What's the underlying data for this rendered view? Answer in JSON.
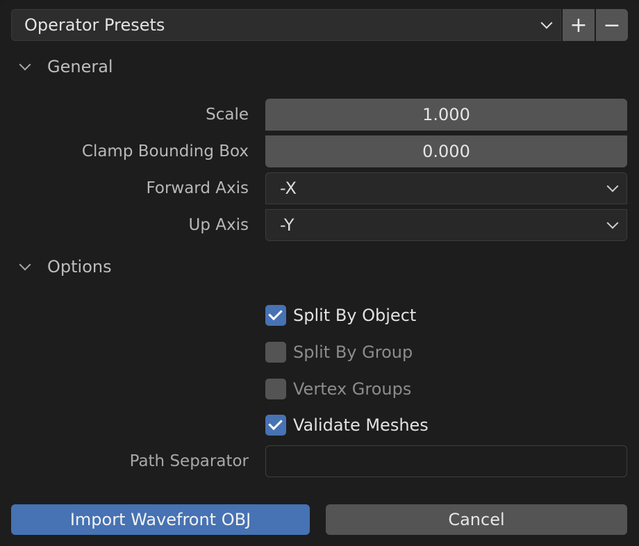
{
  "presets": {
    "label": "Operator Presets",
    "add_glyph": "+",
    "remove_glyph": "−"
  },
  "sections": {
    "general": {
      "title": "General"
    },
    "options": {
      "title": "Options"
    }
  },
  "general": {
    "scale": {
      "label": "Scale",
      "value": "1.000"
    },
    "clamp": {
      "label": "Clamp Bounding Box",
      "value": "0.000"
    },
    "forward_axis": {
      "label": "Forward Axis",
      "value": "-X"
    },
    "up_axis": {
      "label": "Up Axis",
      "value": "-Y"
    }
  },
  "options": {
    "split_by_object": {
      "label": "Split By Object",
      "checked": true
    },
    "split_by_group": {
      "label": "Split By Group",
      "checked": false
    },
    "vertex_groups": {
      "label": "Vertex Groups",
      "checked": false
    },
    "validate_meshes": {
      "label": "Validate Meshes",
      "checked": true
    },
    "path_separator": {
      "label": "Path Separator",
      "value": ""
    }
  },
  "footer": {
    "import_label": "Import Wavefront OBJ",
    "cancel_label": "Cancel"
  },
  "colors": {
    "accent": "#4772b3",
    "panel_bg": "#1d1d1d",
    "field_bg": "#545454"
  }
}
